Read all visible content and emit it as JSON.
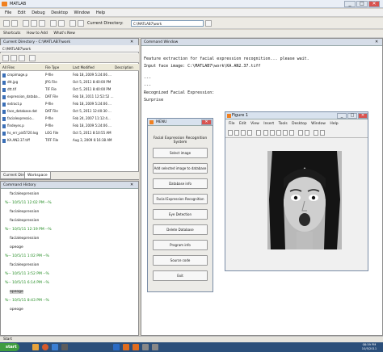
{
  "window": {
    "title": "MATLAB",
    "controls": [
      "_",
      "□",
      "✕"
    ]
  },
  "menubar": [
    "File",
    "Edit",
    "Debug",
    "Desktop",
    "Window",
    "Help"
  ],
  "toolbar": {
    "current_dir_label": "Current Directory:",
    "current_dir_value": "C:\\MATLAB7\\work"
  },
  "shortcuts": [
    "Shortcuts",
    "How to Add",
    "What's New"
  ],
  "current_directory": {
    "panel_title": "Current Directory - C:\\MATLAB7\\work",
    "path": "C:\\MATLAB7\\work",
    "columns": [
      "All Files",
      "File Type",
      "Last Modified",
      "Description"
    ],
    "files": [
      {
        "name": "cropimage.p",
        "type": "P-file",
        "modified": "Feb 18, 2009 5:24:06 ..."
      },
      {
        "name": "dtt.jpg",
        "type": "JPG File",
        "modified": "Oct 5, 2011 8:40:00 PM"
      },
      {
        "name": "dtt.tif",
        "type": "TIF File",
        "modified": "Oct 5, 2011 8:40:00 PM"
      },
      {
        "name": "expression_databa...",
        "type": "DAT File",
        "modified": "Feb 18, 2011 12:52:52 ..."
      },
      {
        "name": "extract.p",
        "type": "P-file",
        "modified": "Feb 18, 2009 5:24:06 ..."
      },
      {
        "name": "face_database.dat",
        "type": "DAT File",
        "modified": "Oct 5, 2011 12:40:30 ..."
      },
      {
        "name": "facialexpressio...",
        "type": "P-file",
        "modified": "Feb 24, 2007 11:12:4..."
      },
      {
        "name": "findeyes.p",
        "type": "P-file",
        "modified": "Feb 18, 2009 5:24:06 ..."
      },
      {
        "name": "hs_err_pid5720.log",
        "type": "LOG File",
        "modified": "Oct 5, 2011 8:10:55 AM"
      },
      {
        "name": "KA.AN2.37.tiff",
        "type": "TIFF File",
        "modified": "Aug 3, 2009 6:16:38 AM"
      }
    ],
    "tabs": [
      "Current Directory",
      "Workspace"
    ]
  },
  "command_history": {
    "panel_title": "Command History",
    "lines": [
      {
        "text": "facialexpression",
        "style": "cmd"
      },
      {
        "text": "%-- 10/5/11 12:02 PM --%",
        "style": "green"
      },
      {
        "text": "facialexpression",
        "style": "cmd"
      },
      {
        "text": "facialexpression",
        "style": "cmd"
      },
      {
        "text": "%-- 10/5/11 12:19 PM --%",
        "style": "green"
      },
      {
        "text": "facialexpression",
        "style": "cmd"
      },
      {
        "text": "opeoge",
        "style": "cmd"
      },
      {
        "text": "%-- 10/5/11  1:02 PM --%",
        "style": "green"
      },
      {
        "text": "facialexpression",
        "style": "cmd"
      },
      {
        "text": "%-- 10/5/11  3:52 PM --%",
        "style": "green"
      },
      {
        "text": "%-- 10/5/11  6:14 PM --%",
        "style": "green"
      },
      {
        "text": "opeoge",
        "style": "selected"
      },
      {
        "text": "%-- 10/5/11  8:43 PM --%",
        "style": "green"
      },
      {
        "text": "opeoge",
        "style": "cmd"
      }
    ]
  },
  "command_window": {
    "panel_title": "Command Window",
    "lines": [
      "Feature extraction for facial expression recognition... please wait.",
      "Input face image: C:\\MATLAB7\\work\\KA.AN2.37.tiff",
      "---",
      "---",
      "Recognized Facial Expression:",
      "  Surprise"
    ]
  },
  "menu_window": {
    "title": "MENU",
    "header": "Facial Expression Recognition System",
    "buttons": [
      "Select image",
      "Add selected image to database",
      "Database info",
      "Facial Expression Recognition",
      "Eye Detection",
      "Delete Database",
      "Program info",
      "Source code",
      "Exit"
    ]
  },
  "figure_window": {
    "title": "Figure 1",
    "menu": [
      "File",
      "Edit",
      "View",
      "Insert",
      "Tools",
      "Desktop",
      "Window",
      "Help"
    ]
  },
  "statusbar": {
    "text": "Start"
  },
  "taskbar": {
    "start_label": "start",
    "clock_time": "08:59 PM",
    "clock_date": "10/5/2011"
  }
}
